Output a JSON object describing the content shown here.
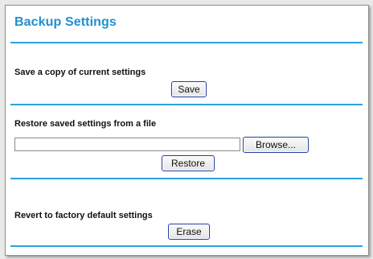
{
  "page": {
    "title": "Backup Settings"
  },
  "save_section": {
    "label": "Save a copy of current settings",
    "button": "Save"
  },
  "restore_section": {
    "label": "Restore saved settings from a file",
    "file_value": "",
    "browse_button": "Browse...",
    "restore_button": "Restore"
  },
  "erase_section": {
    "label": "Revert to factory default settings",
    "button": "Erase"
  },
  "colors": {
    "title": "#1f8fcf",
    "rule": "#2aa3de",
    "button_border": "#1f3f9f"
  }
}
